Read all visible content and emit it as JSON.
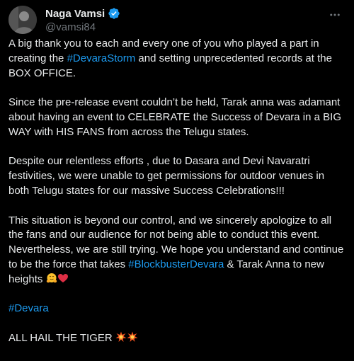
{
  "author": {
    "display_name": "Naga Vamsi",
    "handle": "@vamsi84",
    "verified": true,
    "avatar_icon": "avatar-photo"
  },
  "colors": {
    "background": "#000000",
    "text": "#e7e9ea",
    "muted": "#71767b",
    "link": "#1d9bf0"
  },
  "post": {
    "p1": {
      "before": "A big thank you to each and every one of you who played a part in creating the ",
      "hashtag": "#DevaraStorm",
      "after": " and setting unprecedented records at the BOX OFFICE."
    },
    "p2": "Since the pre-release event couldn’t be held, Tarak anna was adamant about having an event to CELEBRATE the Success of Devara in a BIG WAY with HIS FANS from across the Telugu states.",
    "p3": "Despite our relentless efforts , due to Dasara and Devi Navaratri festivities, we were unable to get permissions for outdoor venues in both Telugu states for our massive Success Celebrations!!!",
    "p4": {
      "before": "This situation is beyond our control, and we sincerely apologize to all the fans and our audience for not being able to conduct this event. Nevertheless, we are still trying. We hope you understand and continue to be the force that takes ",
      "hashtag": "#BlockbusterDevara",
      "after": " & Tarak Anna to new heights ",
      "emoji_icons": [
        "hugging-face-emoji",
        "red-heart-emoji"
      ]
    },
    "p5_hashtag": "#Devara",
    "p6": {
      "text": "ALL HAIL THE TIGER ",
      "emoji_icons": [
        "collision-emoji",
        "collision-emoji"
      ]
    }
  }
}
